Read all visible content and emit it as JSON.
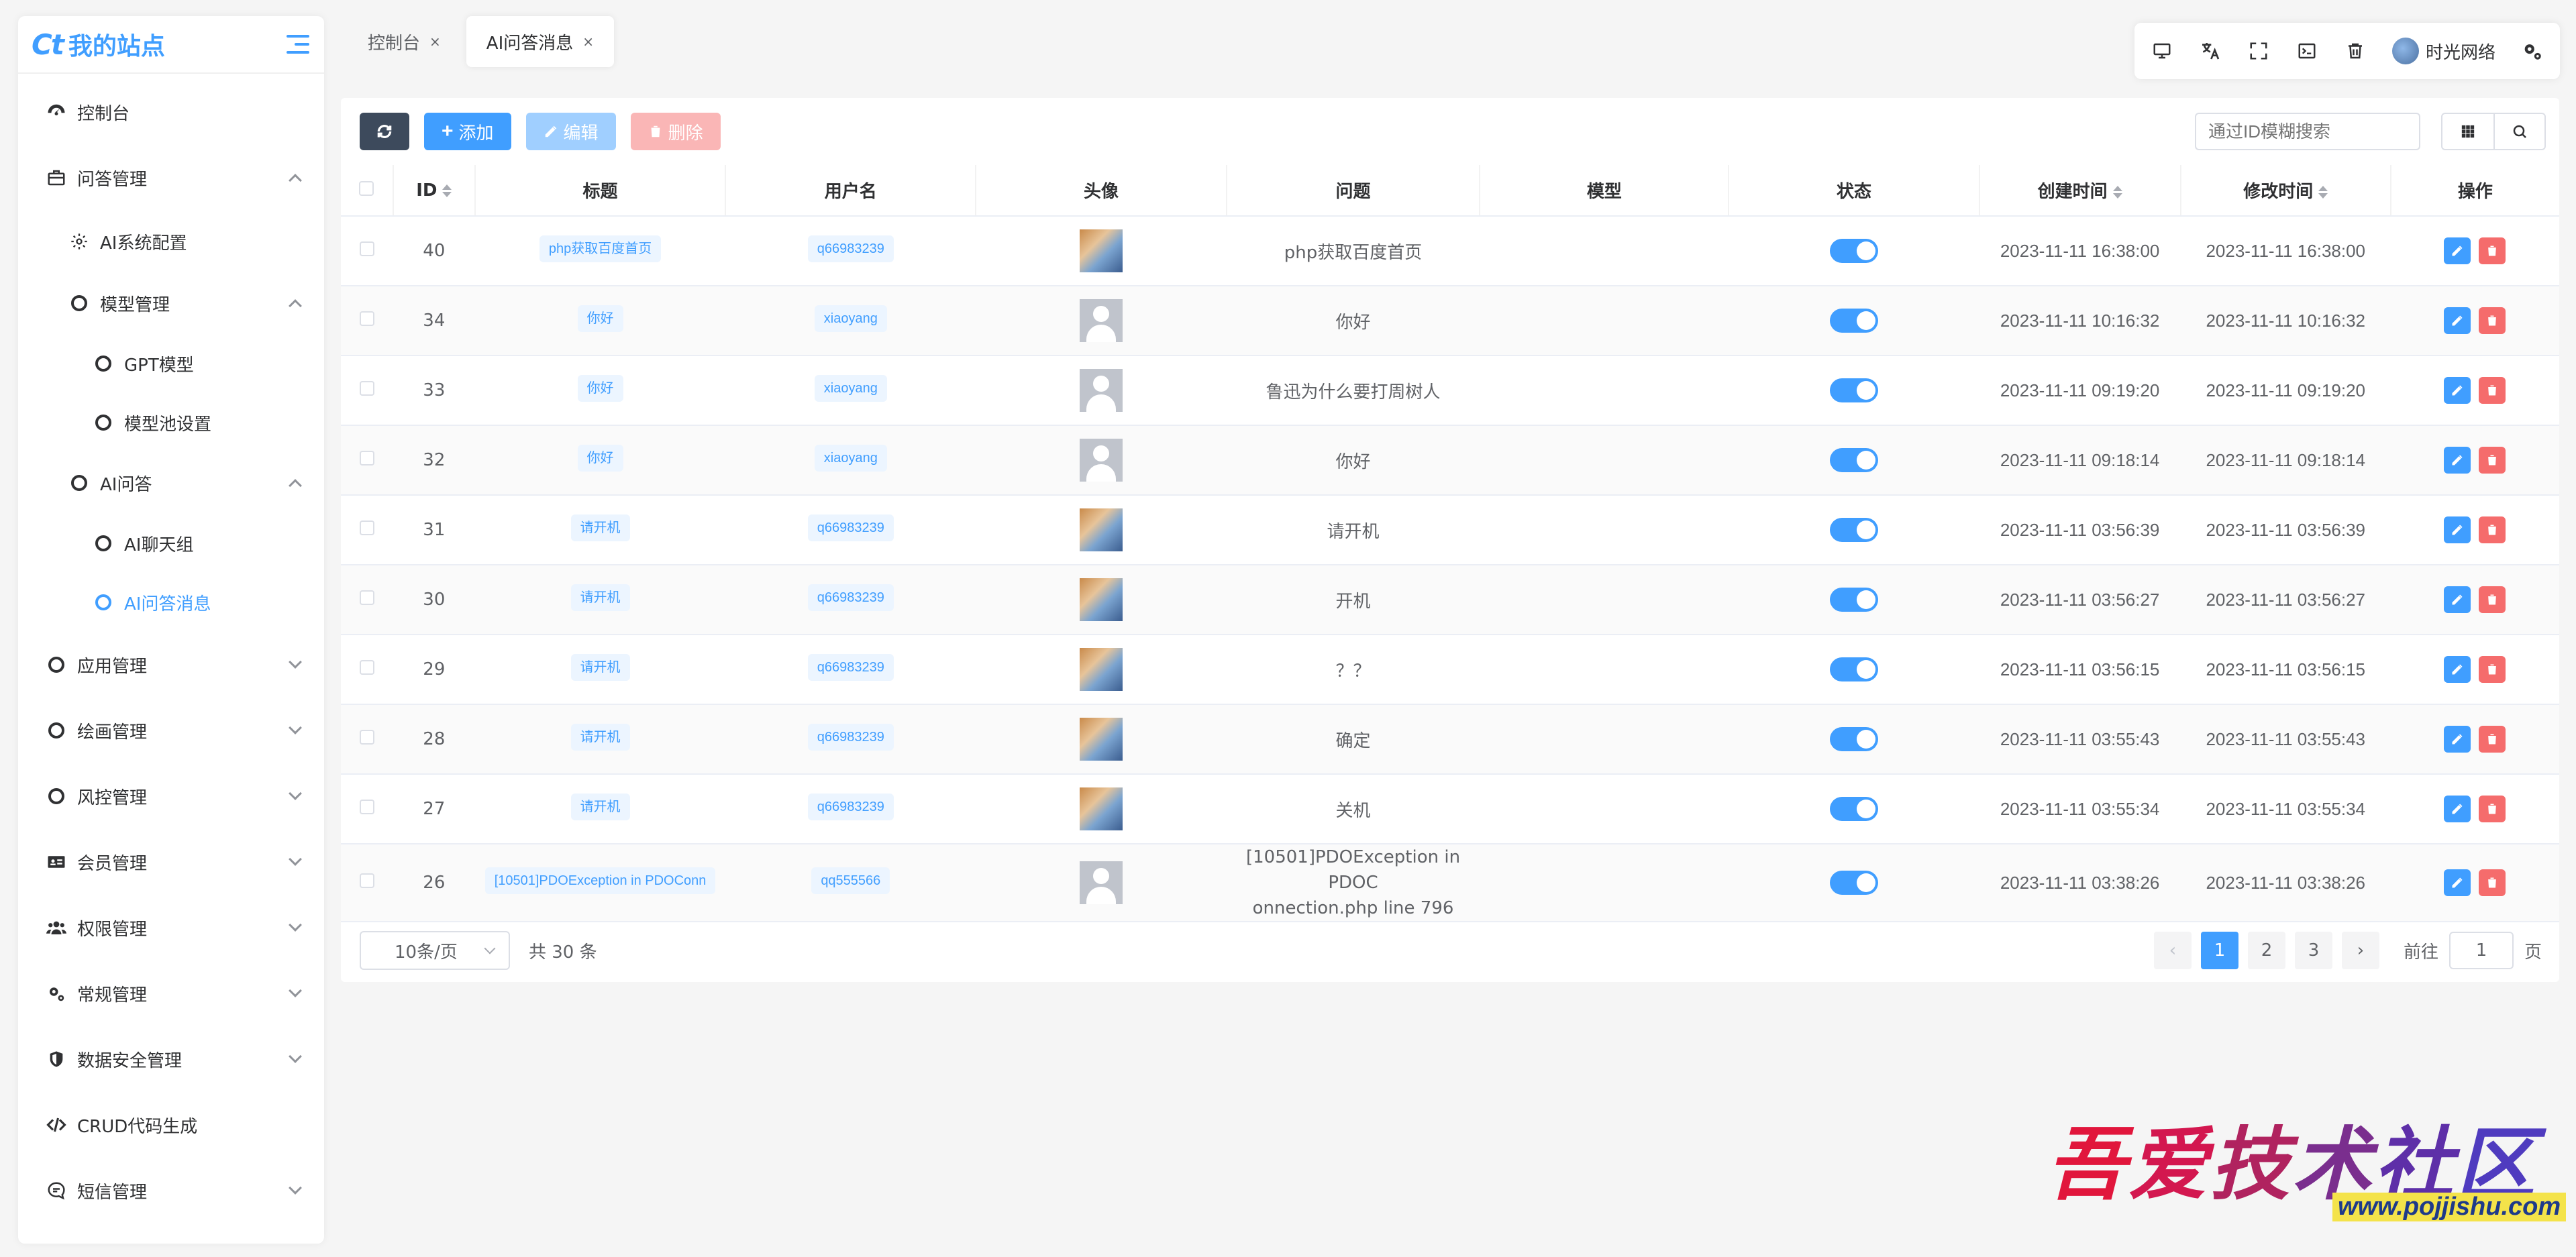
{
  "app": {
    "logo": "Ct",
    "site_name": "我的站点"
  },
  "sidebar": {
    "items": [
      {
        "label": "控制台",
        "level": 0,
        "icon": "dashboard-icon"
      },
      {
        "label": "问答管理",
        "level": 0,
        "icon": "qa-icon",
        "expanded": true
      },
      {
        "label": "AI系统配置",
        "level": 1,
        "icon": "gear-icon"
      },
      {
        "label": "模型管理",
        "level": 1,
        "icon": "circle-icon",
        "expanded": true
      },
      {
        "label": "GPT模型",
        "level": 2,
        "icon": "circle-icon"
      },
      {
        "label": "模型池设置",
        "level": 2,
        "icon": "circle-icon"
      },
      {
        "label": "AI问答",
        "level": 1,
        "icon": "circle-icon",
        "expanded": true
      },
      {
        "label": "AI聊天组",
        "level": 2,
        "icon": "circle-icon"
      },
      {
        "label": "AI问答消息",
        "level": 2,
        "icon": "circle-icon",
        "active": true
      },
      {
        "label": "应用管理",
        "level": 0,
        "icon": "circle-icon"
      },
      {
        "label": "绘画管理",
        "level": 0,
        "icon": "circle-icon"
      },
      {
        "label": "风控管理",
        "level": 0,
        "icon": "circle-icon"
      },
      {
        "label": "会员管理",
        "level": 0,
        "icon": "id-card-icon"
      },
      {
        "label": "权限管理",
        "level": 0,
        "icon": "users-icon"
      },
      {
        "label": "常规管理",
        "level": 0,
        "icon": "gears-icon"
      },
      {
        "label": "数据安全管理",
        "level": 0,
        "icon": "shield-icon"
      },
      {
        "label": "CRUD代码生成",
        "level": 0,
        "icon": "code-icon"
      },
      {
        "label": "短信管理",
        "level": 0,
        "icon": "message-icon"
      }
    ]
  },
  "tabs": [
    {
      "label": "控制台",
      "close": "×"
    },
    {
      "label": "AI问答消息",
      "close": "×",
      "active": true
    }
  ],
  "header": {
    "user_name": "时光网络"
  },
  "toolbar": {
    "add_label": "添加",
    "edit_label": "编辑",
    "delete_label": "删除",
    "search_placeholder": "通过ID模糊搜索"
  },
  "table": {
    "columns": [
      "ID",
      "标题",
      "用户名",
      "头像",
      "问题",
      "模型",
      "状态",
      "创建时间",
      "修改时间",
      "操作"
    ],
    "rows": [
      {
        "id": "40",
        "title": "php获取百度首页",
        "user": "q66983239",
        "avatar": "anime",
        "question": "php获取百度首页",
        "model": "",
        "status": true,
        "created": "2023-11-11 16:38:00",
        "modified": "2023-11-11 16:38:00"
      },
      {
        "id": "34",
        "title": "你好",
        "user": "xiaoyang",
        "avatar": "default",
        "question": "你好",
        "model": "",
        "status": true,
        "created": "2023-11-11 10:16:32",
        "modified": "2023-11-11 10:16:32"
      },
      {
        "id": "33",
        "title": "你好",
        "user": "xiaoyang",
        "avatar": "default",
        "question": "鲁迅为什么要打周树人",
        "model": "",
        "status": true,
        "created": "2023-11-11 09:19:20",
        "modified": "2023-11-11 09:19:20"
      },
      {
        "id": "32",
        "title": "你好",
        "user": "xiaoyang",
        "avatar": "default",
        "question": "你好",
        "model": "",
        "status": true,
        "created": "2023-11-11 09:18:14",
        "modified": "2023-11-11 09:18:14"
      },
      {
        "id": "31",
        "title": "请开机",
        "user": "q66983239",
        "avatar": "anime",
        "question": "请开机",
        "model": "",
        "status": true,
        "created": "2023-11-11 03:56:39",
        "modified": "2023-11-11 03:56:39"
      },
      {
        "id": "30",
        "title": "请开机",
        "user": "q66983239",
        "avatar": "anime",
        "question": "开机",
        "model": "",
        "status": true,
        "created": "2023-11-11 03:56:27",
        "modified": "2023-11-11 03:56:27"
      },
      {
        "id": "29",
        "title": "请开机",
        "user": "q66983239",
        "avatar": "anime",
        "question": "？？",
        "model": "",
        "status": true,
        "created": "2023-11-11 03:56:15",
        "modified": "2023-11-11 03:56:15"
      },
      {
        "id": "28",
        "title": "请开机",
        "user": "q66983239",
        "avatar": "anime",
        "question": "确定",
        "model": "",
        "status": true,
        "created": "2023-11-11 03:55:43",
        "modified": "2023-11-11 03:55:43"
      },
      {
        "id": "27",
        "title": "请开机",
        "user": "q66983239",
        "avatar": "anime",
        "question": "关机",
        "model": "",
        "status": true,
        "created": "2023-11-11 03:55:34",
        "modified": "2023-11-11 03:55:34"
      },
      {
        "id": "26",
        "title": "[10501]PDOException in PDOConn",
        "user": "qq555566",
        "avatar": "default",
        "question_lines": [
          "[10501]PDOException in PDOC",
          "onnection.php line 796"
        ],
        "model": "",
        "status": true,
        "created": "2023-11-11 03:38:26",
        "modified": "2023-11-11 03:38:26"
      }
    ]
  },
  "pagination": {
    "page_size": "10条/页",
    "total": "共 30 条",
    "pages": [
      "1",
      "2",
      "3"
    ],
    "current": "1",
    "goto_prefix": "前往",
    "goto_value": "1",
    "goto_suffix": "页"
  },
  "watermark": {
    "title_chars": [
      "吾",
      "爱",
      "技",
      "术",
      "社",
      "区"
    ],
    "url": "www.pojjishu.com"
  },
  "colors": {
    "primary": "#409eff",
    "danger": "#f56c6c",
    "dark": "#3d4a5c"
  }
}
